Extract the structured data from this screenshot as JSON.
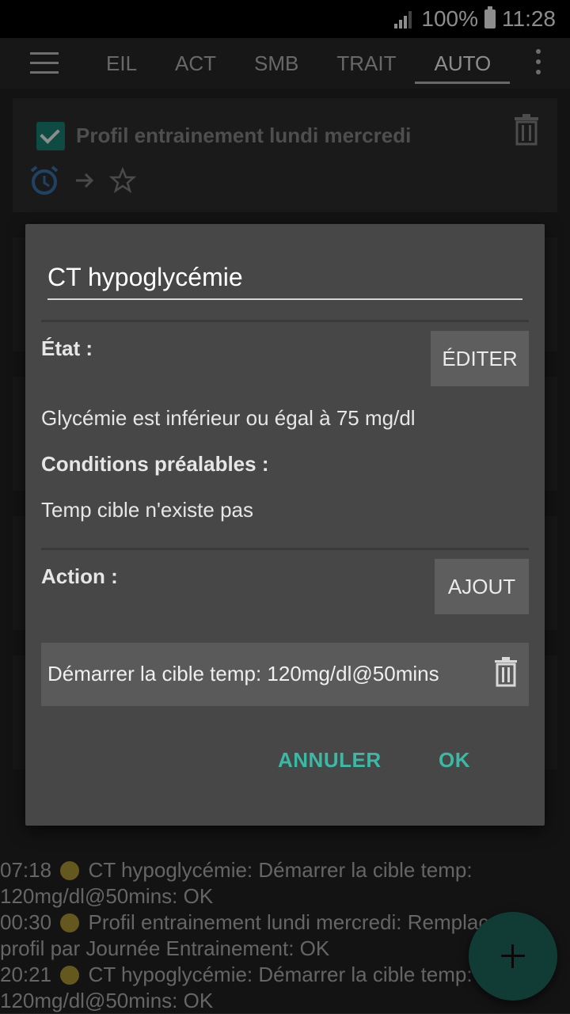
{
  "status_bar": {
    "battery_percent": "100%",
    "time": "11:28"
  },
  "tabs": [
    "EIL",
    "ACT",
    "SMB",
    "TRAIT",
    "AUTO"
  ],
  "active_tab": "AUTO",
  "cards": [
    {
      "title": "Profil entrainement lundi mercredi",
      "checked": true
    }
  ],
  "dialog": {
    "title_value": "CT hypoglycémie",
    "etat_label": "État :",
    "edit_button": "ÉDITER",
    "condition_text": "Glycémie est inférieur ou égal à 75 mg/dl",
    "preconditions_label": "Conditions préalables :",
    "precondition_text": "Temp cible n'existe pas",
    "action_label": "Action :",
    "add_button": "AJOUT",
    "action_item": "Démarrer la cible temp: 120mg/dl@50mins",
    "cancel_button": "ANNULER",
    "ok_button": "OK"
  },
  "log": [
    {
      "time": "07:18",
      "text": "CT hypoglycémie: Démarrer la cible temp: 120mg/dl@50mins: OK"
    },
    {
      "time": "00:30",
      "text": "Profil entrainement lundi mercredi: Remplacer le profil par Journée Entrainement: OK"
    },
    {
      "time": "20:21",
      "text": "CT hypoglycémie: Démarrer la cible temp: 120mg/dl@50mins: OK"
    }
  ],
  "colors": {
    "accent": "#3bb9a4",
    "fab": "#1e6e62",
    "dialog_bg": "#474747"
  }
}
